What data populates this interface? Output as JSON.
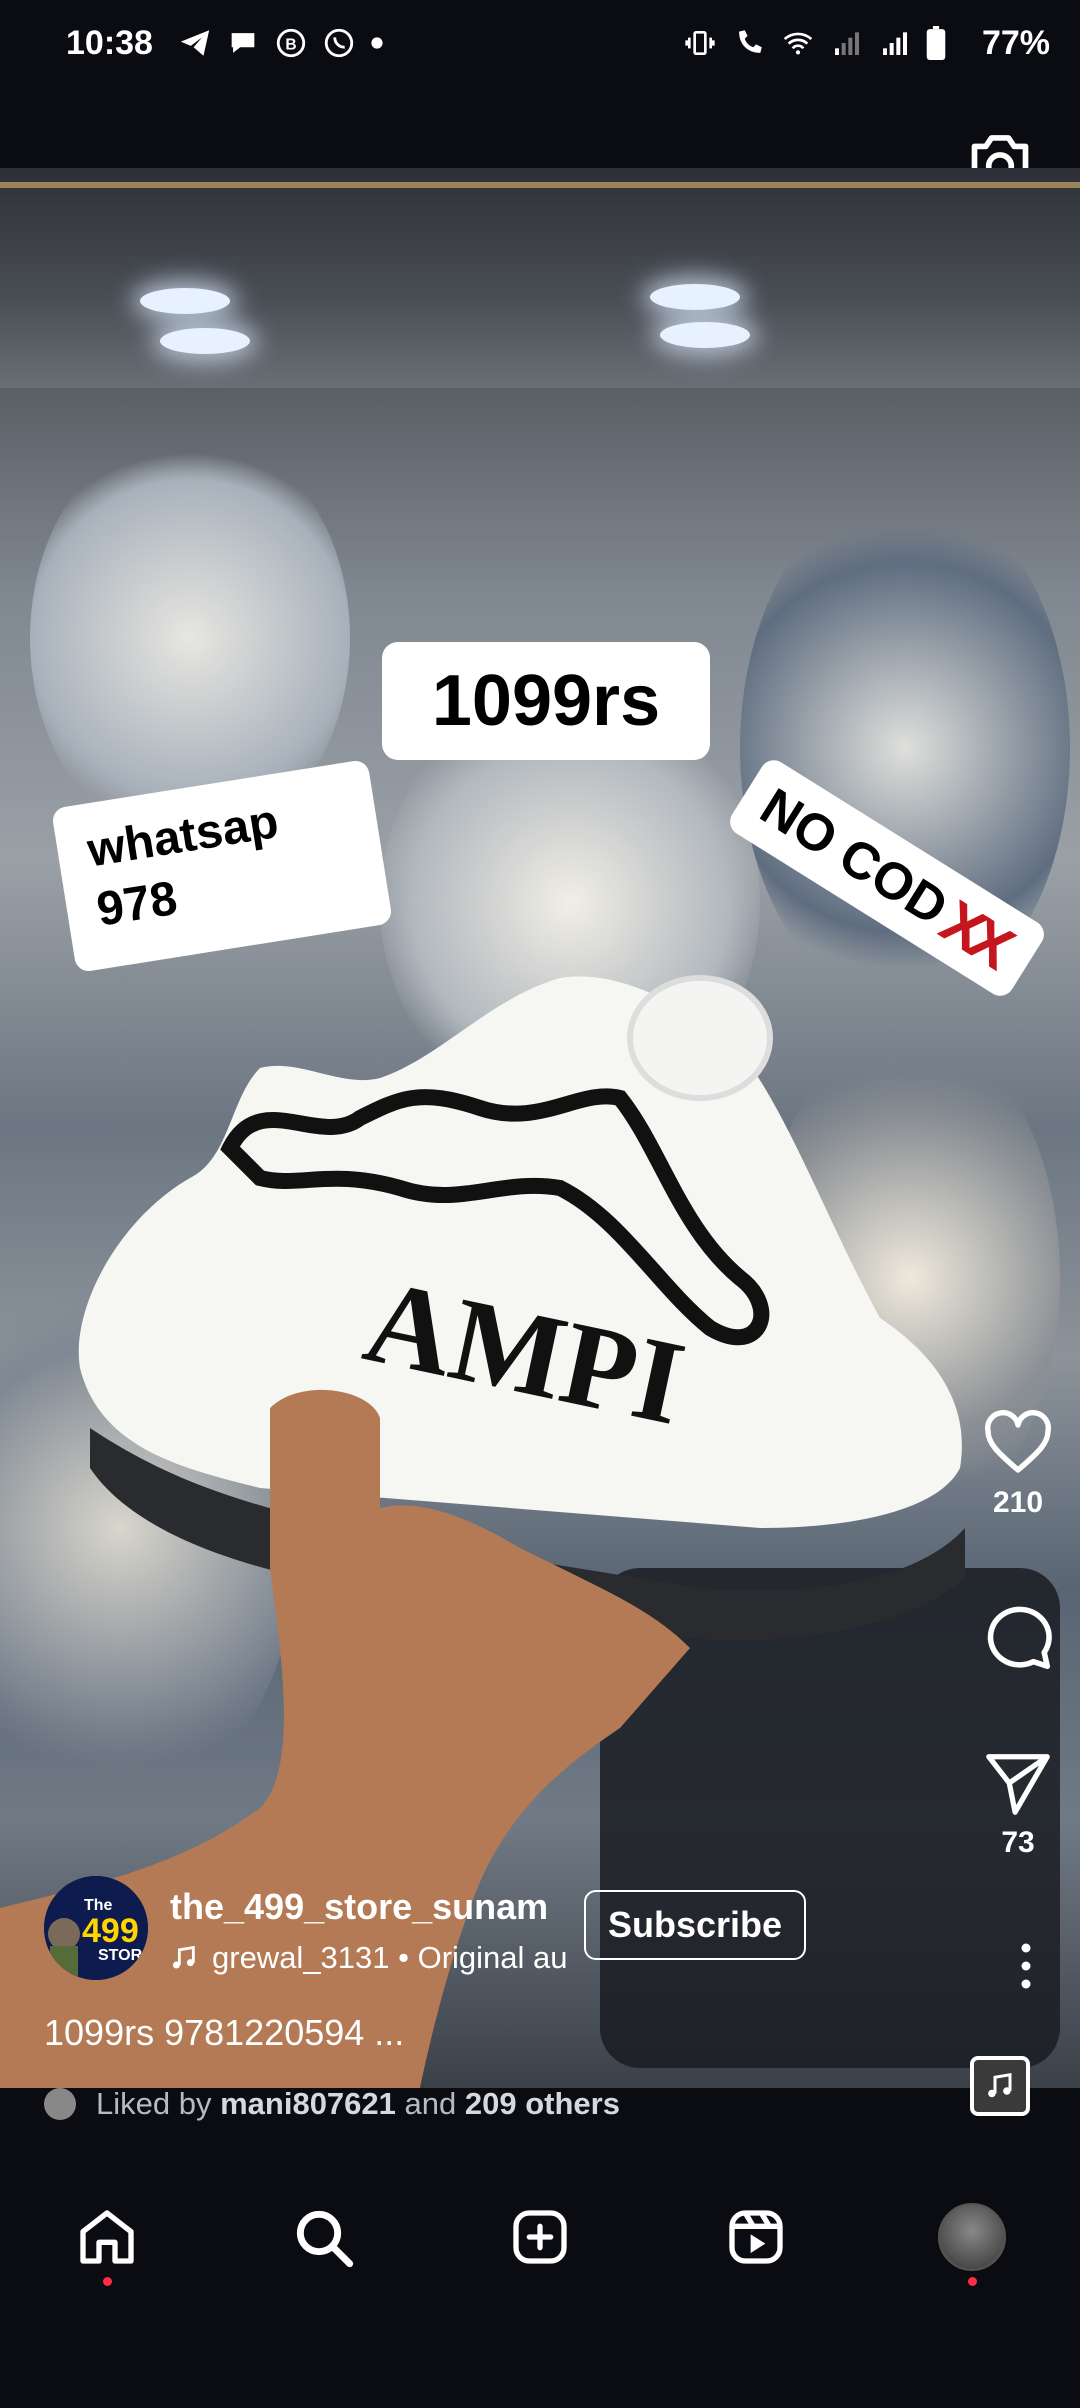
{
  "status_bar": {
    "time": "10:38",
    "battery": "77%",
    "left_icons": [
      "telegram-icon",
      "chat-bubble-icon",
      "b-messenger-icon",
      "whatsapp-icon",
      "notification-dot-icon"
    ],
    "right_icons": [
      "vibrate-icon",
      "wifi-calling-icon",
      "wifi-icon",
      "signal-weak-icon",
      "signal-icon",
      "battery-icon"
    ]
  },
  "reel": {
    "stickers": {
      "price": "1099rs",
      "whatsapp_line1": "whatsap",
      "whatsapp_line2": "978",
      "no_cod": "NO COD",
      "no_cod_marks": "XX"
    },
    "likes": "210",
    "shares": "73",
    "author": {
      "username": "the_499_store_sunam",
      "avatar_text_top": "The",
      "avatar_text_mid": "499",
      "avatar_text_bottom": "STOR",
      "subscribe_label": "Subscribe",
      "audio": "grewal_3131 • Original au"
    },
    "caption": "1099rs 9781220594 ...",
    "liked_by": {
      "prefix": "Liked by",
      "user": "mani807621",
      "middle": "and",
      "others": "209 others"
    }
  },
  "colors": {
    "background": "#0b0c12",
    "notification_dot": "#ff2d45",
    "cross_red": "#c4161c"
  },
  "nav": {
    "items": [
      "home-icon",
      "search-icon",
      "create-icon",
      "reels-icon",
      "profile-avatar"
    ]
  }
}
